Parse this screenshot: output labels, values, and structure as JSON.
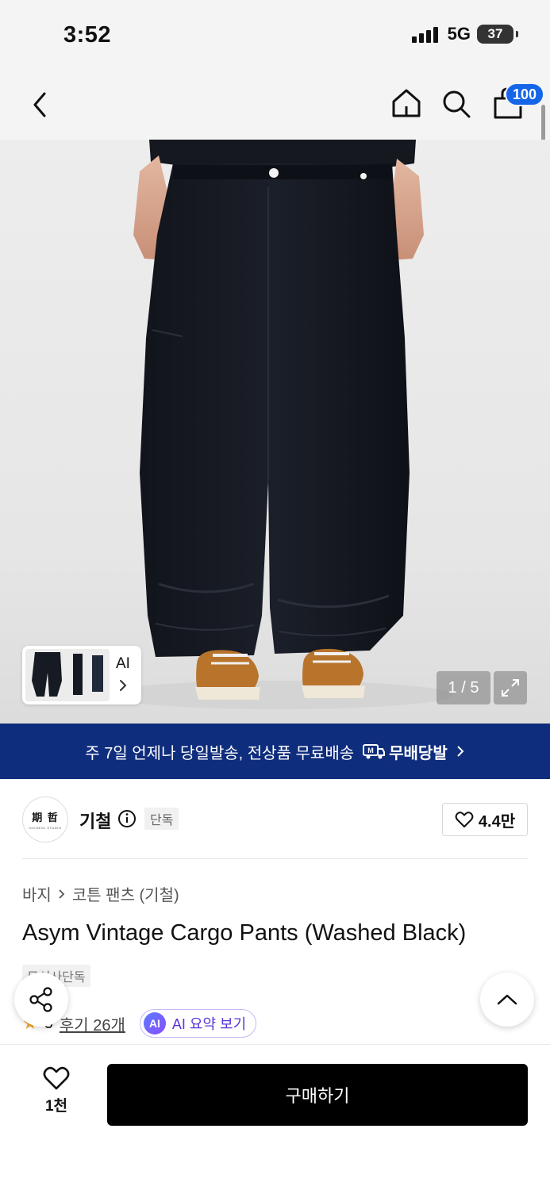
{
  "status_bar": {
    "time": "3:52",
    "network": "5G",
    "battery": "37"
  },
  "nav": {
    "cart_count": "100"
  },
  "hero": {
    "thumb_label": "AI",
    "counter": "1 / 5"
  },
  "banner": {
    "text": "주 7일 언제나 당일발송, 전상품 무료배송",
    "logo_text": "무배당발"
  },
  "brand": {
    "logo_main": "期 哲",
    "logo_sub": "GICHEOL STUDIO",
    "name": "기철",
    "tag": "단독",
    "likes": "4.4만"
  },
  "breadcrumb": {
    "category": "바지",
    "subcategory": "코튼 팬츠 (기철)"
  },
  "product": {
    "title": "Asym Vintage Cargo Pants (Washed Black)",
    "badge": "무신사단독",
    "rating": "5",
    "review_text": "후기 26개",
    "ai_badge": "AI",
    "ai_summary": "AI 요약 보기"
  },
  "bottom": {
    "wish_count": "1천",
    "buy_label": "구매하기"
  },
  "colors": {
    "accent_blue": "#1565e8",
    "banner_bg": "#0f2d7d",
    "ai_purple": "#5b35d5",
    "star": "#f5a623"
  }
}
